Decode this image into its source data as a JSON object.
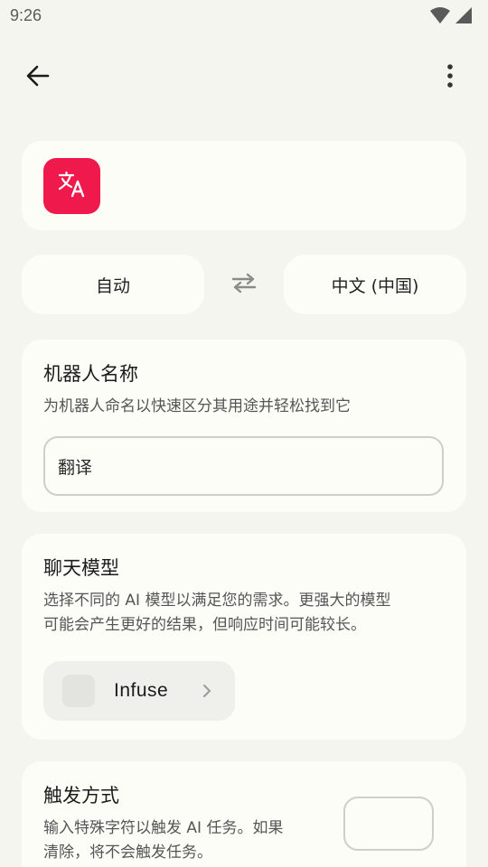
{
  "status_bar": {
    "time": "9:26",
    "icons": [
      "wifi-icon",
      "signal-icon"
    ]
  },
  "toolbar": {
    "back_icon": "arrow-left-icon",
    "more_icon": "more-vertical-icon"
  },
  "app": {
    "icon": "translate-icon",
    "icon_color": "#f0194b"
  },
  "language": {
    "source": "自动",
    "target": "中文 (中国)",
    "swap_icon": "swap-icon"
  },
  "name_section": {
    "title": "机器人名称",
    "description": "为机器人命名以快速区分其用途并轻松找到它",
    "value": "翻译"
  },
  "model_section": {
    "title": "聊天模型",
    "description_line1": "选择不同的 AI 模型以满足您的需求。更强大的模型",
    "description_line2": "可能会产生更好的结果，但响应时间可能较长。",
    "model_name": "Infuse"
  },
  "trigger_section": {
    "title": "触发方式",
    "description_line1": "输入特殊字符以触发 AI 任务。如果",
    "description_line2": "清除，将不会触发任务。",
    "value": ""
  },
  "colors": {
    "background": "#f5f5ef",
    "card": "#fdfdf8",
    "accent": "#f0194b"
  }
}
